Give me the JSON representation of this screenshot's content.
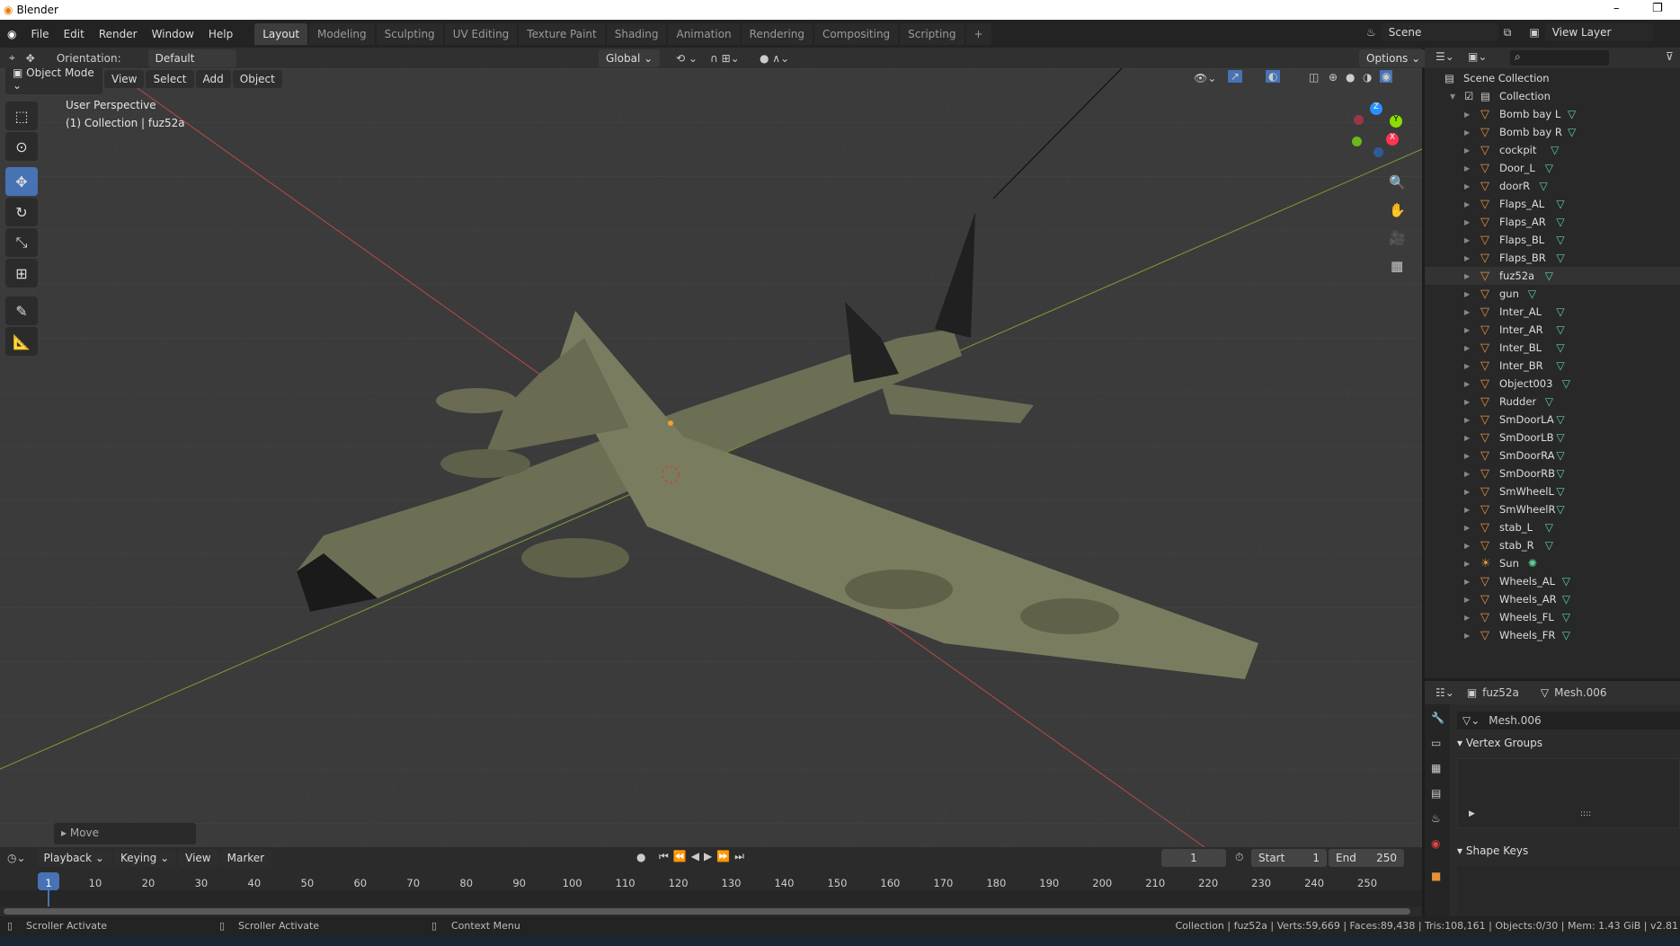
{
  "window": {
    "title": "Blender",
    "minimize": "–",
    "restore": "❐"
  },
  "menus": [
    "File",
    "Edit",
    "Render",
    "Window",
    "Help"
  ],
  "workspaces": [
    "Layout",
    "Modeling",
    "Sculpting",
    "UV Editing",
    "Texture Paint",
    "Shading",
    "Animation",
    "Rendering",
    "Compositing",
    "Scripting",
    "+"
  ],
  "active_workspace": "Layout",
  "scene": {
    "label": "Scene",
    "view_layer": "View Layer"
  },
  "tool_header": {
    "orientation_label": "Orientation:",
    "orientation_value": "Default",
    "transform": "Global",
    "options": "Options"
  },
  "viewport": {
    "mode": "Object Mode",
    "menus": [
      "View",
      "Select",
      "Add",
      "Object"
    ],
    "perspective": "User Perspective",
    "collection_info": "(1) Collection | fuz52a",
    "last_op": "Move",
    "axes": {
      "x": "X",
      "y": "Y",
      "z": "Z"
    },
    "axis_colors": {
      "x": "#ff3352",
      "y": "#8bdc00",
      "z": "#2890ff"
    }
  },
  "outliner": {
    "root": "Scene Collection",
    "collection": "Collection",
    "items": [
      {
        "name": "Bomb bay L",
        "type": "mesh"
      },
      {
        "name": "Bomb bay R",
        "type": "mesh"
      },
      {
        "name": "cockpit",
        "type": "mesh"
      },
      {
        "name": "Door_L",
        "type": "mesh"
      },
      {
        "name": "doorR",
        "type": "mesh"
      },
      {
        "name": "Flaps_AL",
        "type": "mesh"
      },
      {
        "name": "Flaps_AR",
        "type": "mesh"
      },
      {
        "name": "Flaps_BL",
        "type": "mesh"
      },
      {
        "name": "Flaps_BR",
        "type": "mesh"
      },
      {
        "name": "fuz52a",
        "type": "mesh",
        "selected": true
      },
      {
        "name": "gun",
        "type": "mesh"
      },
      {
        "name": "Inter_AL",
        "type": "mesh"
      },
      {
        "name": "Inter_AR",
        "type": "mesh"
      },
      {
        "name": "Inter_BL",
        "type": "mesh"
      },
      {
        "name": "Inter_BR",
        "type": "mesh"
      },
      {
        "name": "Object003",
        "type": "mesh"
      },
      {
        "name": "Rudder",
        "type": "mesh"
      },
      {
        "name": "SmDoorLA",
        "type": "mesh"
      },
      {
        "name": "SmDoorLB",
        "type": "mesh"
      },
      {
        "name": "SmDoorRA",
        "type": "mesh"
      },
      {
        "name": "SmDoorRB",
        "type": "mesh"
      },
      {
        "name": "SmWheelL",
        "type": "mesh"
      },
      {
        "name": "SmWheelR",
        "type": "mesh"
      },
      {
        "name": "stab_L",
        "type": "mesh"
      },
      {
        "name": "stab_R",
        "type": "mesh"
      },
      {
        "name": "Sun",
        "type": "light"
      },
      {
        "name": "Wheels_AL",
        "type": "mesh"
      },
      {
        "name": "Wheels_AR",
        "type": "mesh"
      },
      {
        "name": "Wheels_FL",
        "type": "mesh"
      },
      {
        "name": "Wheels_FR",
        "type": "mesh"
      }
    ]
  },
  "properties": {
    "object": "fuz52a",
    "mesh": "Mesh.006",
    "mesh_field": "Mesh.006",
    "panels": [
      "Vertex Groups",
      "Shape Keys"
    ]
  },
  "timeline": {
    "menus": [
      "Playback",
      "Keying",
      "View",
      "Marker"
    ],
    "current_frame": "1",
    "start_label": "Start",
    "start": "1",
    "end_label": "End",
    "end": "250",
    "ticks": [
      "1",
      "10",
      "20",
      "30",
      "40",
      "50",
      "60",
      "70",
      "80",
      "90",
      "100",
      "110",
      "120",
      "130",
      "140",
      "150",
      "160",
      "170",
      "180",
      "190",
      "200",
      "210",
      "220",
      "230",
      "240",
      "250"
    ]
  },
  "statusbar": {
    "left": "Scroller Activate",
    "middle": "Scroller Activate",
    "right": "Context Menu",
    "stats": "Collection | fuz52a | Verts:59,669 | Faces:89,438 | Tris:108,161 | Objects:0/30 | Mem: 1.43 GiB | v2.81"
  },
  "colors": {
    "accent": "#4772b3",
    "mesh_icon": "#e69138",
    "data_icon": "#5fd29f"
  }
}
